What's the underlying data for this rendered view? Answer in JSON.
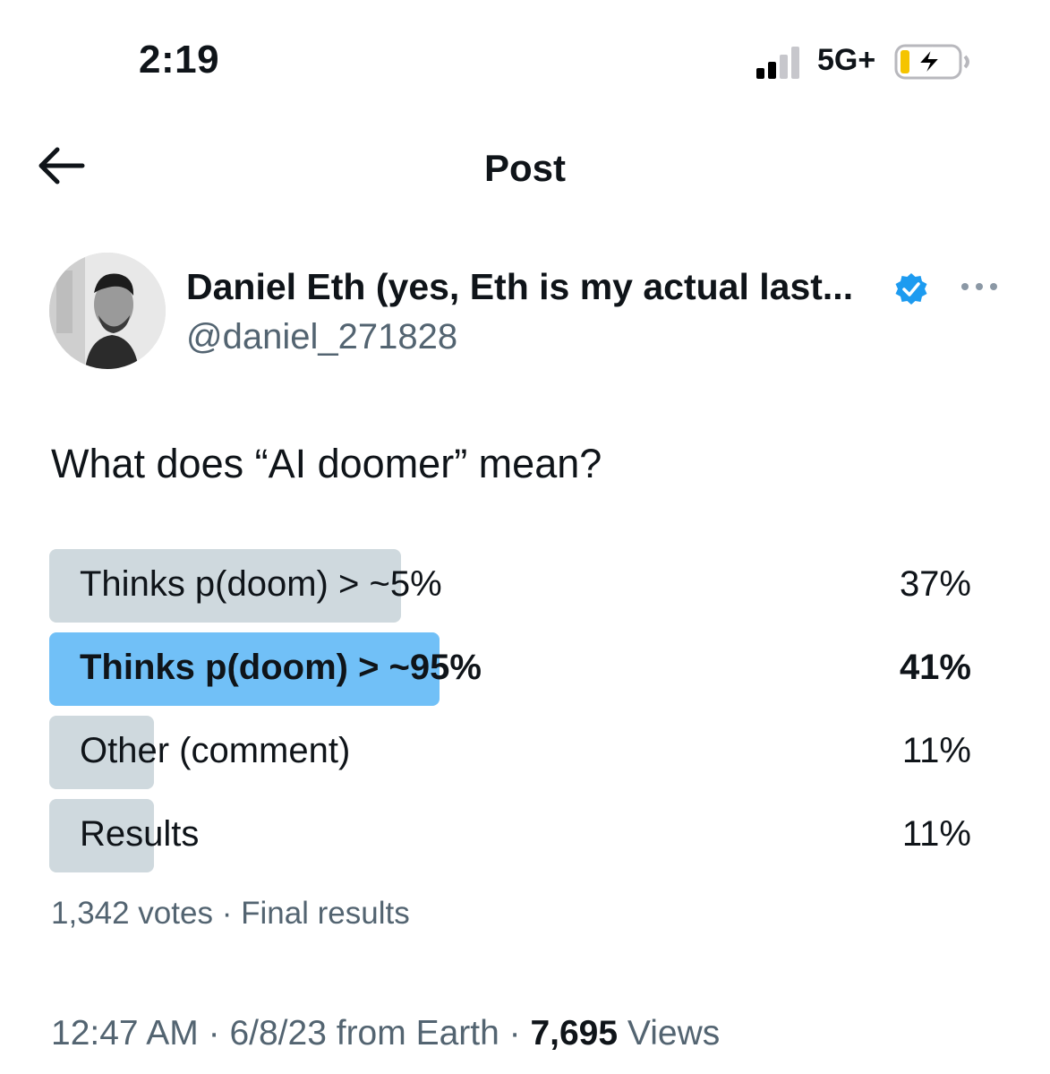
{
  "status_bar": {
    "time": "2:19",
    "network": "5G+",
    "battery": "charging"
  },
  "header": {
    "title": "Post",
    "back_icon": "arrow-left-icon"
  },
  "author": {
    "name": "Daniel Eth (yes, Eth is my actual last...",
    "handle": "@daniel_271828",
    "verified": true
  },
  "post": {
    "text": "What does “AI doomer” mean?"
  },
  "poll": {
    "options": [
      {
        "label": "Thinks p(doom) > ~5%",
        "percent_text": "37%",
        "fraction": 0.37,
        "winner": false
      },
      {
        "label": "Thinks p(doom) > ~95%",
        "percent_text": "41%",
        "fraction": 0.41,
        "winner": true
      },
      {
        "label": "Other (comment)",
        "percent_text": "11%",
        "fraction": 0.11,
        "winner": false
      },
      {
        "label": "Results",
        "percent_text": "11%",
        "fraction": 0.11,
        "winner": false
      }
    ],
    "votes_text": "1,342 votes · Final results"
  },
  "timestamp": {
    "time": "12:47 AM",
    "date": "6/8/23",
    "source": "from Earth",
    "views_count": "7,695",
    "views_label": "Views"
  },
  "colors": {
    "winner_bar": "#71c0f7",
    "bar": "#cfd9de",
    "verified": "#1d9bf0",
    "secondary_text": "#536471"
  }
}
